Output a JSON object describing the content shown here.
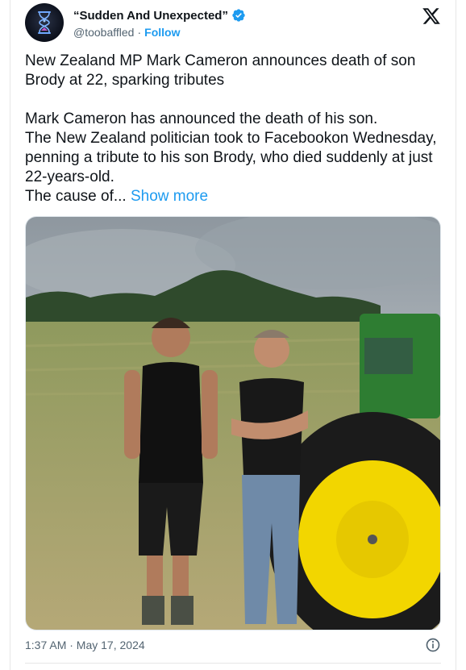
{
  "author": {
    "display_name": "“Sudden And Unexpected”",
    "handle": "@toobaffled",
    "separator": "·",
    "follow_label": "Follow",
    "verified": true
  },
  "brand_icon": "x-logo-icon",
  "tweet": {
    "headline": "New Zealand MP Mark Cameron announces death of son Brody at 22, sparking tributes",
    "body_line1": "Mark Cameron has announced the death of his son.",
    "body_line2": "The New Zealand politician took to Facebookon Wednesday, penning a tribute to his son Brody, who died suddenly at just 22-years-old.",
    "body_line3": "The cause of...",
    "show_more": "Show more"
  },
  "media": {
    "icon": "photo-image",
    "description_hidden": true
  },
  "footer": {
    "timestamp": "1:37 AM · May 17, 2024",
    "info_icon": "info-icon"
  },
  "colors": {
    "accent": "#1d9bf0",
    "text": "#0f1419",
    "muted": "#536471",
    "tractor_green": "#2e7d32",
    "wheel_yellow": "#f2d600"
  }
}
